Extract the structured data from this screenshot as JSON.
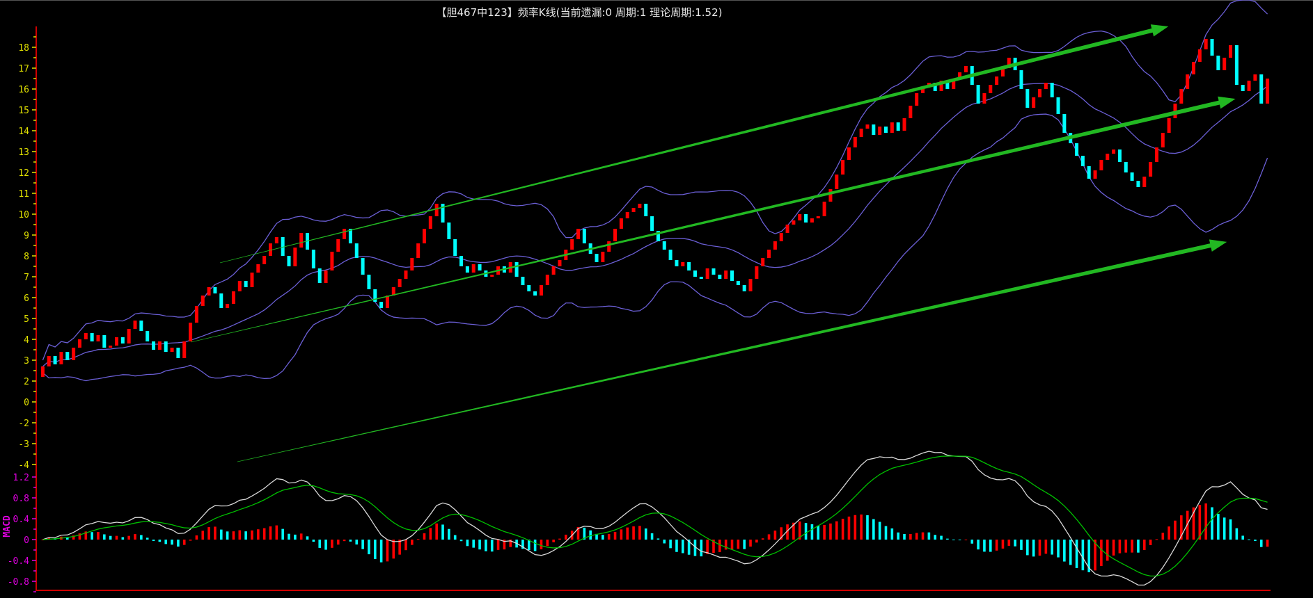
{
  "title": "【胆467中123】频率K线(当前遗漏:0 周期:1 理论周期:1.52)",
  "colors": {
    "up": "#ff0000",
    "down": "#00ffff",
    "band": "#6b5fd6",
    "dif": "#d8d8d8",
    "dea": "#00c000",
    "axis": "#d00000",
    "price_label": "#e0e000",
    "macd_label": "#e000e0",
    "trend": "#22b822"
  },
  "chart_data": [
    {
      "type": "candlestick",
      "title": "频率K线",
      "ylim": [
        -2.5,
        19.2
      ],
      "y_ticks": [
        {
          "label": "18",
          "value": 18
        },
        {
          "label": "17",
          "value": 17
        },
        {
          "label": "16",
          "value": 16
        },
        {
          "label": "15",
          "value": 15
        },
        {
          "label": "14",
          "value": 14
        },
        {
          "label": "13",
          "value": 13
        },
        {
          "label": "12",
          "value": 12
        },
        {
          "label": "11",
          "value": 11
        },
        {
          "label": "10",
          "value": 10
        },
        {
          "label": "9",
          "value": 9
        },
        {
          "label": "8",
          "value": 8
        },
        {
          "label": "7",
          "value": 7
        },
        {
          "label": "6",
          "value": 6
        },
        {
          "label": "5",
          "value": 5
        },
        {
          "label": "4",
          "value": 4
        },
        {
          "label": "3",
          "value": 3
        },
        {
          "label": "2",
          "value": 2
        },
        {
          "label": "0",
          "value": 1
        },
        {
          "label": "-2",
          "value": 0
        },
        {
          "label": "-3",
          "value": -1
        },
        {
          "label": "-4",
          "value": -2
        }
      ],
      "close": [
        2.7,
        3.2,
        2.8,
        3.4,
        3.0,
        3.6,
        4.0,
        4.3,
        3.9,
        4.2,
        3.6,
        3.7,
        4.1,
        3.8,
        4.5,
        4.9,
        4.4,
        3.9,
        3.5,
        3.9,
        3.4,
        3.6,
        3.1,
        3.9,
        4.8,
        5.6,
        6.1,
        6.5,
        6.2,
        5.5,
        5.7,
        6.3,
        6.8,
        6.5,
        7.2,
        7.6,
        8.0,
        8.6,
        8.9,
        8.0,
        7.5,
        8.4,
        9.1,
        8.3,
        7.4,
        6.7,
        7.3,
        8.2,
        8.8,
        9.3,
        8.6,
        7.9,
        7.1,
        6.4,
        5.8,
        5.5,
        6.1,
        6.5,
        6.9,
        7.3,
        7.9,
        8.6,
        9.3,
        9.9,
        10.5,
        9.6,
        8.8,
        8.0,
        7.5,
        7.2,
        7.6,
        7.3,
        7.0,
        7.1,
        7.5,
        7.2,
        7.7,
        7.0,
        6.6,
        6.3,
        6.1,
        6.6,
        7.1,
        7.5,
        7.8,
        8.3,
        8.8,
        9.3,
        8.6,
        8.1,
        7.7,
        8.2,
        8.7,
        9.3,
        9.8,
        10.1,
        10.3,
        10.5,
        9.9,
        9.2,
        8.7,
        8.3,
        7.8,
        7.5,
        7.7,
        7.3,
        7.0,
        6.9,
        7.4,
        7.1,
        6.9,
        7.3,
        6.8,
        6.6,
        6.3,
        6.9,
        7.5,
        7.9,
        8.3,
        8.7,
        9.1,
        9.5,
        9.7,
        10.0,
        9.6,
        9.8,
        9.9,
        10.6,
        11.2,
        11.9,
        12.6,
        13.2,
        13.7,
        14.1,
        14.3,
        13.8,
        14.2,
        13.9,
        14.4,
        14.0,
        14.6,
        15.2,
        15.8,
        16.1,
        16.3,
        15.9,
        16.4,
        16.0,
        16.5,
        16.8,
        17.1,
        16.2,
        15.3,
        15.8,
        16.2,
        16.6,
        17.0,
        17.5,
        16.9,
        16.0,
        15.1,
        15.6,
        16.0,
        16.3,
        15.6,
        14.8,
        13.9,
        13.4,
        12.8,
        12.3,
        11.7,
        12.1,
        12.6,
        12.9,
        13.1,
        12.5,
        12.0,
        11.6,
        11.3,
        11.8,
        12.5,
        13.2,
        13.9,
        14.6,
        15.3,
        16.0,
        16.7,
        17.3,
        17.9,
        18.4,
        17.6,
        16.9,
        17.5,
        18.1,
        16.2,
        15.9,
        16.4,
        16.7,
        15.3,
        16.5
      ],
      "bollinger": {
        "period": 20,
        "k": 2
      },
      "trendlines": [
        {
          "from": [
            28.8,
            7.67
          ],
          "to": [
            182.9,
            19.0
          ]
        },
        {
          "from": [
            24.1,
            3.87
          ],
          "to": [
            193.8,
            15.53
          ]
        },
        {
          "from": [
            31.6,
            -1.87
          ],
          "to": [
            192.4,
            8.67
          ]
        }
      ]
    },
    {
      "type": "macd",
      "label": "MACD",
      "ylim": [
        -0.97,
        1.3
      ],
      "y_ticks": [
        {
          "label": "1.2",
          "value": 1.2
        },
        {
          "label": "0.8",
          "value": 0.8
        },
        {
          "label": "0.4",
          "value": 0.4
        },
        {
          "label": "0",
          "value": 0
        },
        {
          "label": "-0.4",
          "value": -0.4
        },
        {
          "label": "-0.8",
          "value": -0.8
        }
      ],
      "params": {
        "fast": 12,
        "slow": 26,
        "signal": 9
      }
    }
  ]
}
